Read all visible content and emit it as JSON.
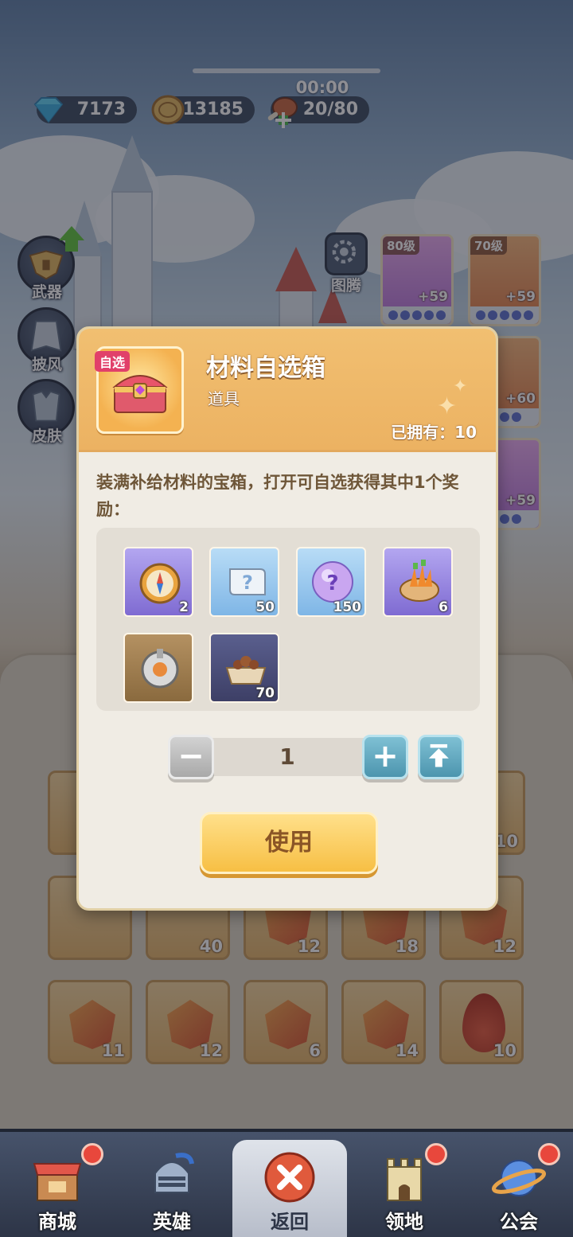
{
  "resources": {
    "diamonds": "7173",
    "coins": "13185",
    "stamina": "20/80",
    "timer": "00:00"
  },
  "side_menu": [
    {
      "label": "武器",
      "icon": "helmet-wing-icon"
    },
    {
      "label": "披风",
      "icon": "cape-icon"
    },
    {
      "label": "皮肤",
      "icon": "armor-icon"
    }
  ],
  "totem": {
    "label": "图腾",
    "icon": "gear-icon"
  },
  "equipment": [
    {
      "level": "80级",
      "plus": "+59",
      "rarity": "purple"
    },
    {
      "level": "70级",
      "plus": "+59",
      "rarity": "orange"
    },
    {
      "level": "",
      "plus": "+60",
      "rarity": "orange"
    },
    {
      "level": "",
      "plus": "+59",
      "rarity": "purple"
    }
  ],
  "inventory_counts": {
    "row_top_right": "10",
    "row1": [
      "",
      "40",
      "12",
      "18",
      "12"
    ],
    "row1_tag": "自选",
    "row2": [
      "11",
      "12",
      "6",
      "14",
      "10"
    ]
  },
  "modal": {
    "tag": "自选",
    "title": "材料自选箱",
    "subtitle": "道具",
    "owned": "已拥有：10",
    "description": "装满补给材料的宝箱，打开可自选获得其中1个奖励：",
    "rewards": [
      {
        "icon": "compass-icon",
        "count": "2",
        "bg": "purple"
      },
      {
        "icon": "mystery-scroll-icon",
        "count": "50",
        "bg": "blue"
      },
      {
        "icon": "mystery-orb-icon",
        "count": "150",
        "bg": "blue"
      },
      {
        "icon": "carrot-basket-icon",
        "count": "6",
        "bg": "purple"
      },
      {
        "icon": "gear-shard-icon",
        "count": "",
        "bg": "brown"
      },
      {
        "icon": "pet-food-bowl-icon",
        "count": "70",
        "bg": "navy"
      }
    ],
    "quantity": "1",
    "use_label": "使用"
  },
  "nav": [
    {
      "label": "商城",
      "icon": "shop-icon",
      "badge": true
    },
    {
      "label": "英雄",
      "icon": "knight-helmet-icon",
      "badge": false
    },
    {
      "label": "返回",
      "icon": "close-icon",
      "badge": false
    },
    {
      "label": "领地",
      "icon": "castle-icon",
      "badge": true
    },
    {
      "label": "公会",
      "icon": "planet-icon",
      "badge": true
    }
  ],
  "colors": {
    "modal_header": "#ecb262",
    "use_button": "#f7bf44",
    "badge_red": "#e8473c",
    "stepper_teal": "#4c95ae"
  }
}
